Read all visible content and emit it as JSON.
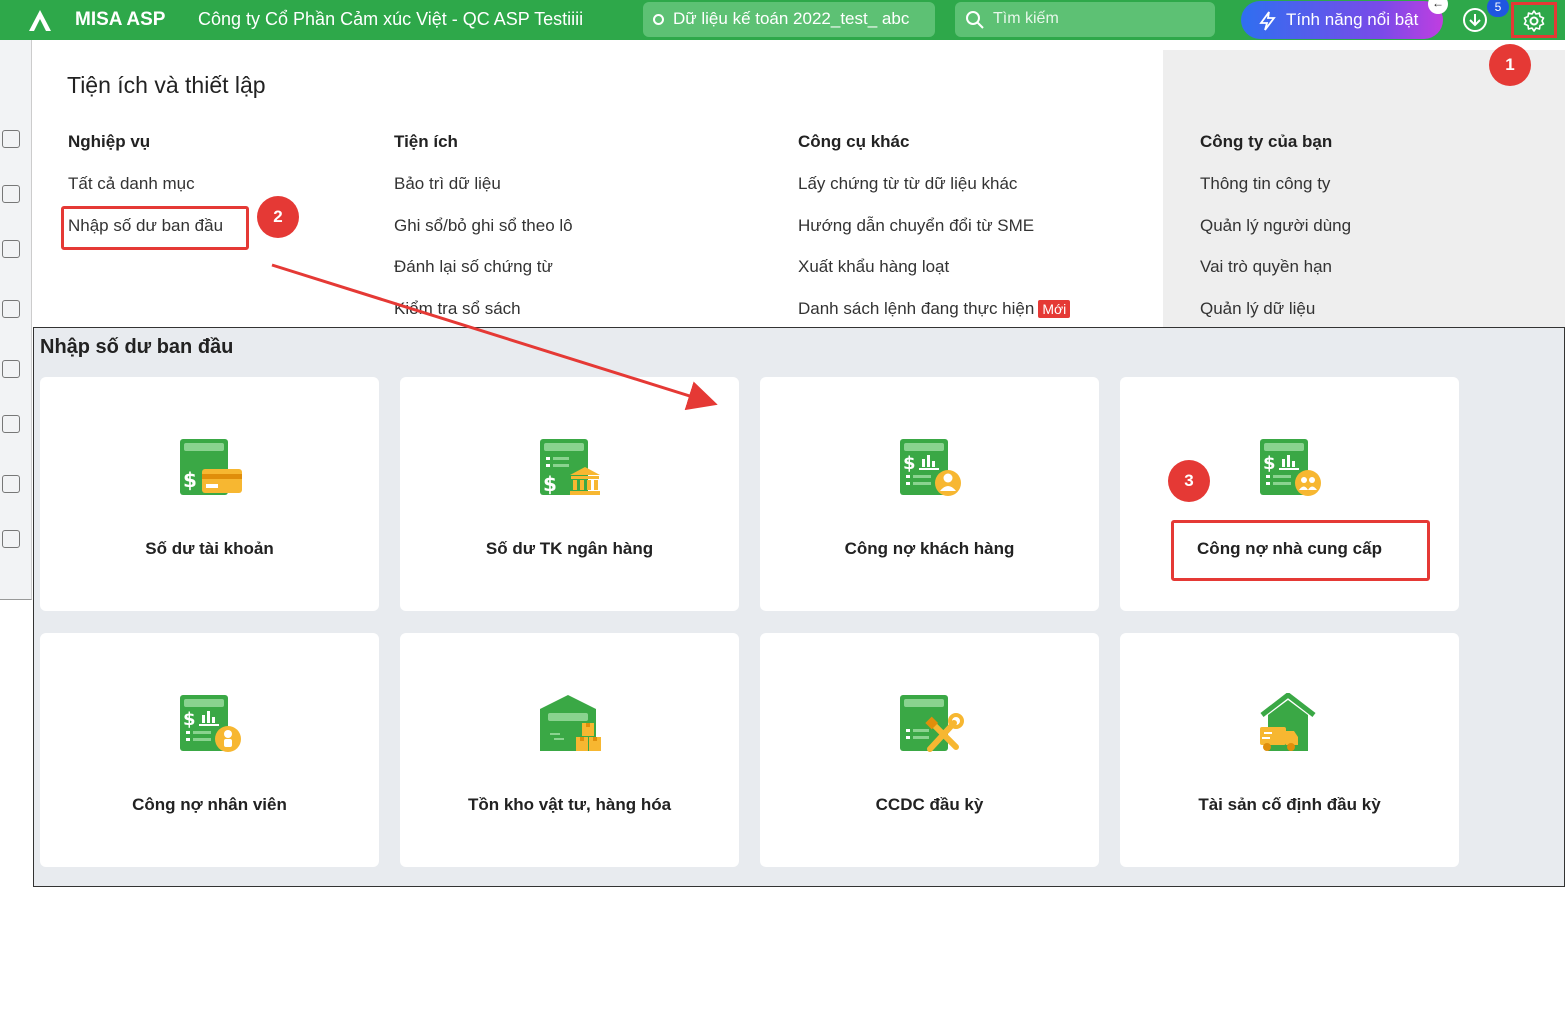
{
  "topbar": {
    "app_name": "MISA ASP",
    "company": "Công ty Cổ Phần Cảm xúc Việt - QC ASP Testiiii",
    "dataset": "Dữ liệu kế toán 2022_test_ abc",
    "search_placeholder": "Tìm kiếm",
    "feature_button": "Tính năng nổi bật",
    "notification_count": "5",
    "colors": {
      "bar": "#2ea84a",
      "highlight": "#e53935"
    }
  },
  "panel": {
    "title": "Tiện ích và thiết lập",
    "columns": [
      {
        "heading": "Nghiệp vụ",
        "items": [
          "Tất cả danh mục",
          "Nhập số dư ban đầu"
        ]
      },
      {
        "heading": "Tiện ích",
        "items": [
          "Bảo trì dữ liệu",
          "Ghi sổ/bỏ ghi sổ theo lô",
          "Đánh lại số chứng từ",
          "Kiểm tra sổ sách"
        ]
      },
      {
        "heading": "Công cụ khác",
        "items": [
          "Lấy chứng từ từ dữ liệu khác",
          "Hướng dẫn chuyển đổi từ SME",
          "Xuất khẩu hàng loạt",
          "Danh sách lệnh đang thực hiện"
        ]
      },
      {
        "heading": "Công ty của bạn",
        "items": [
          "Thông tin công ty",
          "Quản lý người dùng",
          "Vai trò quyền hạn",
          "Quản lý dữ liệu"
        ]
      }
    ],
    "new_badge": "Mới"
  },
  "steps": [
    "1",
    "2",
    "3"
  ],
  "dialog": {
    "title": "Nhập số dư ban đầu",
    "cards": [
      {
        "label": "Số dư tài khoản",
        "icon": "ledger-card-icon"
      },
      {
        "label": "Số dư TK ngân hàng",
        "icon": "ledger-bank-icon"
      },
      {
        "label": "Công nợ khách hàng",
        "icon": "ledger-customer-icon"
      },
      {
        "label": "Công nợ nhà cung cấp",
        "icon": "ledger-supplier-icon"
      },
      {
        "label": "Công nợ nhân viên",
        "icon": "ledger-employee-icon"
      },
      {
        "label": "Tồn kho vật tư, hàng hóa",
        "icon": "warehouse-icon"
      },
      {
        "label": "CCDC đầu kỳ",
        "icon": "tools-icon"
      },
      {
        "label": "Tài sản cố định đầu kỳ",
        "icon": "fixed-asset-icon"
      }
    ]
  }
}
